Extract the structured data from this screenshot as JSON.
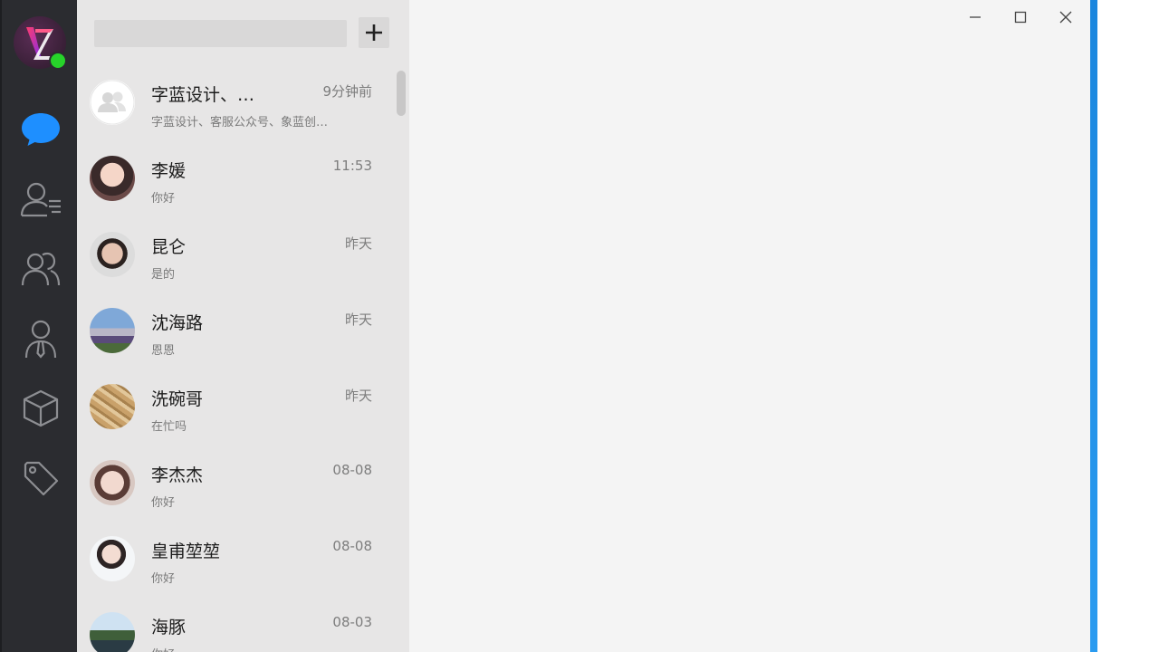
{
  "window": {
    "minimize_icon": "minimize-icon",
    "maximize_icon": "maximize-icon",
    "close_icon": "close-icon"
  },
  "rail": {
    "logo_icon": "app-logo-icon",
    "status": "online",
    "items": [
      {
        "name": "chat",
        "icon": "chat-bubble-icon",
        "active": true
      },
      {
        "name": "contacts",
        "icon": "contact-list-icon",
        "active": false
      },
      {
        "name": "groups",
        "icon": "group-icon",
        "active": false
      },
      {
        "name": "organization",
        "icon": "person-tie-icon",
        "active": false
      },
      {
        "name": "apps",
        "icon": "cube-icon",
        "active": false
      },
      {
        "name": "tags",
        "icon": "tag-icon",
        "active": false
      }
    ],
    "active_color": "#1e8fff",
    "icon_color": "#8d8e92"
  },
  "search": {
    "value": "",
    "placeholder": ""
  },
  "conversations": [
    {
      "name": "字蓝设计、…",
      "time": "9分钟前",
      "preview": "字蓝设计、客服公众号、象蓝创…",
      "avatar": "group-avatar-icon"
    },
    {
      "name": "李媛",
      "time": "11:53",
      "preview": "你好",
      "avatar": "user-avatar"
    },
    {
      "name": "昆仑",
      "time": "昨天",
      "preview": "是的",
      "avatar": "user-avatar"
    },
    {
      "name": "沈海路",
      "time": "昨天",
      "preview": "恩恩",
      "avatar": "user-avatar"
    },
    {
      "name": "洗碗哥",
      "time": "昨天",
      "preview": "在忙吗",
      "avatar": "user-avatar"
    },
    {
      "name": "李杰杰",
      "time": "08-08",
      "preview": "你好",
      "avatar": "user-avatar"
    },
    {
      "name": "皇甫堃堃",
      "time": "08-08",
      "preview": "你好",
      "avatar": "user-avatar"
    },
    {
      "name": "海豚",
      "time": "08-03",
      "preview": "你好",
      "avatar": "user-avatar"
    }
  ]
}
